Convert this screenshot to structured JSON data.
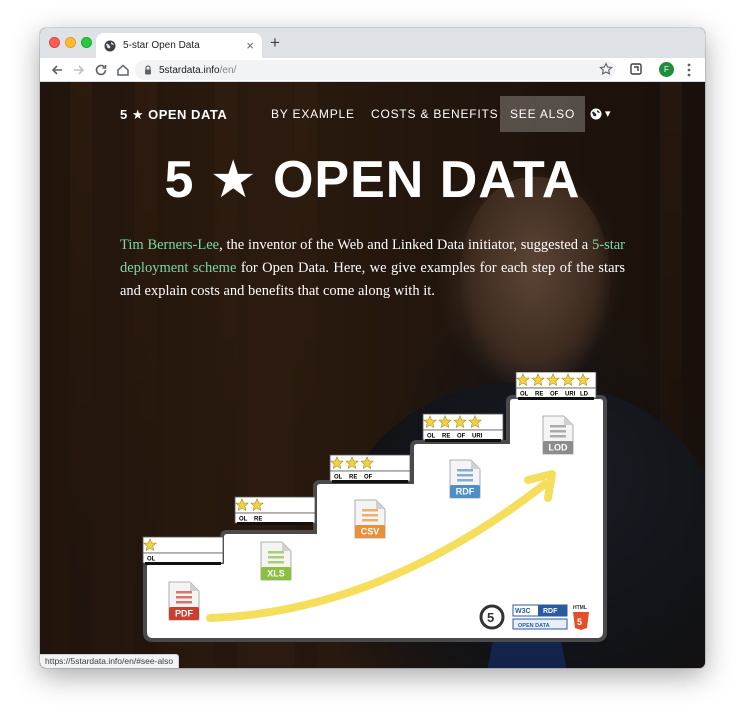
{
  "browser": {
    "tab_title": "5-star Open Data",
    "tab_close": "×",
    "new_tab": "+",
    "url_host": "5stardata.info",
    "url_path": "/en/",
    "avatar_initial": "F",
    "status_url": "https://5stardata.info/en/#see-also"
  },
  "nav": {
    "brand": "5 ★ OPEN DATA",
    "links": [
      "BY EXAMPLE",
      "COSTS & BENEFITS",
      "SEE ALSO"
    ],
    "active_link": "SEE ALSO",
    "language_caret": "▾"
  },
  "hero": {
    "title": "5 ★ OPEN DATA",
    "intro_link1": "Tim Berners-Lee",
    "intro_text1": ", the inventor of the Web and Linked Data initiator, suggested a ",
    "intro_link2": "5-star deployment scheme",
    "intro_text2": " for Open Data. Here, we give examples for each step of the stars and explain costs and benefits that come along with it."
  },
  "stairs": {
    "steps": [
      {
        "stars": 1,
        "codes": [
          "OL"
        ],
        "format": "PDF",
        "color": "#c9402e"
      },
      {
        "stars": 2,
        "codes": [
          "OL",
          "RE"
        ],
        "format": "XLS",
        "color": "#8cbf3f"
      },
      {
        "stars": 3,
        "codes": [
          "OL",
          "RE",
          "OF"
        ],
        "format": "CSV",
        "color": "#e8913a"
      },
      {
        "stars": 4,
        "codes": [
          "OL",
          "RE",
          "OF",
          "URI"
        ],
        "format": "RDF",
        "color": "#4f8fc8"
      },
      {
        "stars": 5,
        "codes": [
          "OL",
          "RE",
          "OF",
          "URI",
          "LD"
        ],
        "format": "LOD",
        "color": "#8c8c8c"
      }
    ],
    "logos": [
      "W3C",
      "RDF",
      "OPEN DATA",
      "HTML",
      "5"
    ],
    "accent_yellow": "#f5de5b"
  }
}
